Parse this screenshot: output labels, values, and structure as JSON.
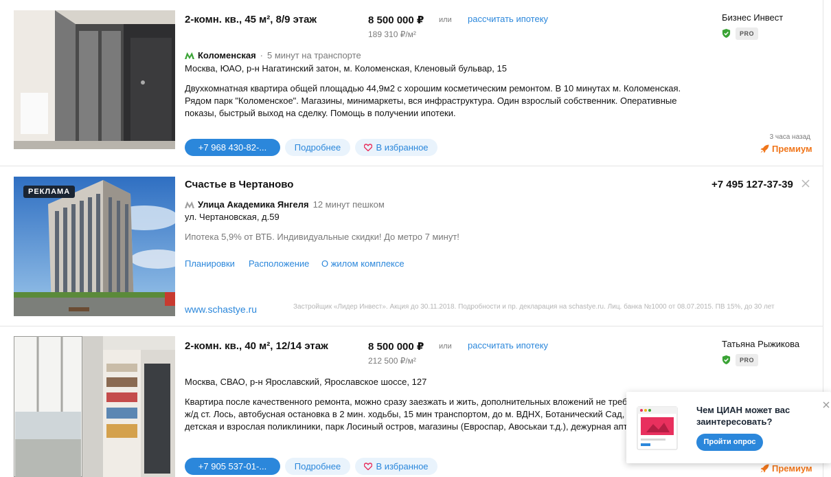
{
  "listing1": {
    "title": "2-комн. кв., 45 м², 8/9 этаж",
    "price": "8 500 000 ₽",
    "price_per_m2": "189 310 ₽/м²",
    "or": "или",
    "mortgage_link": "рассчитать ипотеку",
    "agent": "Бизнес Инвест",
    "agent_badge": "PRO",
    "metro_station": "Коломенская",
    "metro_separator": "·",
    "metro_time": "5 минут на транспорте",
    "address": "Москва, ЮАО, р-н Нагатинский затон, м. Коломенская, Кленовый бульвар, 15",
    "description": "Двухкомнатная квартира общей площадью 44,9м2 с хорошим косметическим ремонтом. В 10 минутах м. Коломенская. Рядом парк \"Коломенское\". Магазины, минимаркеты, вся инфраструктура. Один взрослый собственник. Оперативные показы, быстрый выход на сделку. Помощь в получении ипотеки.",
    "phone_button": "+7 968 430-82-...",
    "more_button": "Подробнее",
    "favorite_button": "В избранное",
    "time_ago": "3 часа назад",
    "premium_label": "Премиум",
    "metro_color": "#3aa335"
  },
  "ad": {
    "badge": "РЕКЛАМА",
    "title": "Счастье в Чертаново",
    "phone": "+7 495 127-37-39",
    "metro_station": "Улица Академика Янгеля",
    "metro_time": "12 минут пешком",
    "address": "ул. Чертановская, д.59",
    "description": "Ипотека 5,9% от ВТБ. Индивидуальные скидки! До метро 7 минут!",
    "links": [
      "Планировки",
      "Расположение",
      "О жилом комплексе"
    ],
    "site": "www.schastye.ru",
    "legal": "Застройщик «Лидер Инвест». Акция до 30.11.2018. Подробности и пр. декларация на schastye.ru. Лиц. банка №1000 от 08.07.2015. ПВ 15%, до 30 лет",
    "metro_color": "#a0a0a0"
  },
  "listing2": {
    "title": "2-комн. кв., 40 м², 12/14 этаж",
    "price": "8 500 000 ₽",
    "price_per_m2": "212 500 ₽/м²",
    "or": "или",
    "mortgage_link": "рассчитать ипотеку",
    "agent": "Татьяна Рыжикова",
    "agent_badge": "PRO",
    "address": "Москва, СВАО, р-н Ярославский, Ярославское шоссе, 127",
    "description_lines": [
      "Квартира после качественного ремонта, можно сразу заезжать и жить, дополнительных вложений не требует.",
      "ж/д ст. Лось, автобусная остановка в 2 мин. ходьбы, 15 мин транспортом, до м. ВДНХ, Ботанический Сад, ряд",
      "детская и взрослая поликлиники, парк Лосиный остров, магазины (Евроспар, Авоськаи т.д.), дежурная аптека, 2"
    ],
    "phone_button": "+7 905 537-01-...",
    "more_button": "Подробнее",
    "favorite_button": "В избранное",
    "premium_label": "Премиум"
  },
  "survey_popup": {
    "title": "Чем ЦИАН может вас заинтересовать?",
    "button": "Пройти опрос"
  },
  "colors": {
    "accent": "#2b87db",
    "premium": "#f0761b",
    "verified": "#3aa335"
  }
}
